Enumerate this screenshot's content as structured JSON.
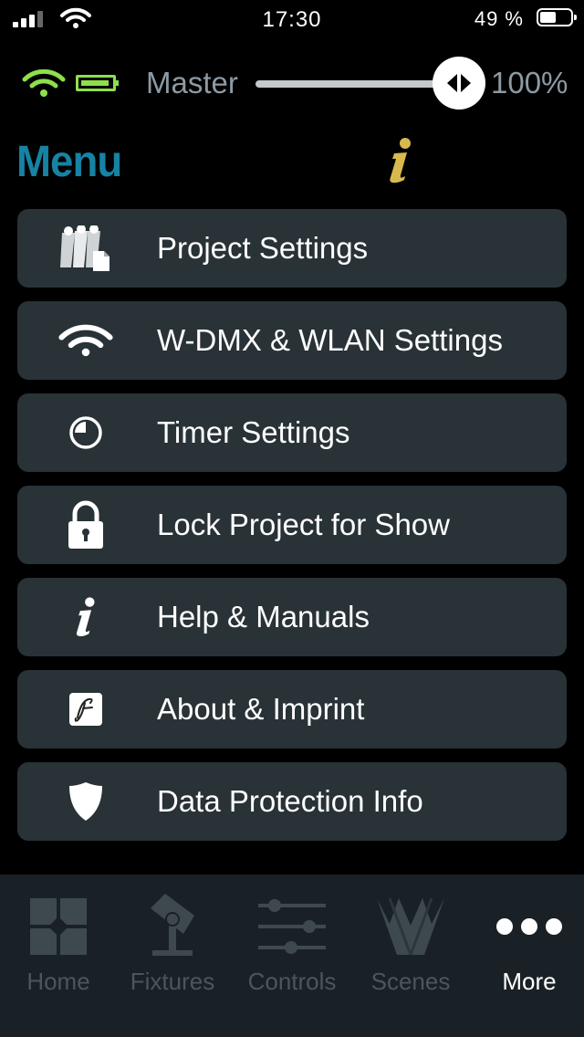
{
  "status_bar": {
    "time": "17:30",
    "battery_percent": "49 %",
    "signal_bars": 3,
    "battery_level": 0.49
  },
  "master": {
    "label": "Master",
    "value_text": "100%",
    "level": 1.0,
    "connection_icon": "wifi-icon",
    "device_battery_icon": "battery-icon",
    "accent_color": "#8ee04b"
  },
  "menu": {
    "title": "Menu",
    "title_color": "#1683a3",
    "info_icon": "info-icon",
    "info_color": "#d8b94e",
    "items": [
      {
        "label": "Project Settings",
        "icon": "fixtures-document-icon"
      },
      {
        "label": "W-DMX & WLAN Settings",
        "icon": "wifi-icon"
      },
      {
        "label": "Timer Settings",
        "icon": "clock-icon"
      },
      {
        "label": "Lock Project for Show",
        "icon": "lock-icon"
      },
      {
        "label": "Help & Manuals",
        "icon": "info-icon"
      },
      {
        "label": "About & Imprint",
        "icon": "signature-icon"
      },
      {
        "label": "Data Protection Info",
        "icon": "shield-icon"
      }
    ]
  },
  "tabbar": {
    "active": "More",
    "tabs": [
      {
        "label": "Home",
        "icon": "home-grid-icon"
      },
      {
        "label": "Fixtures",
        "icon": "fixture-icon"
      },
      {
        "label": "Controls",
        "icon": "sliders-icon"
      },
      {
        "label": "Scenes",
        "icon": "scenes-icon"
      },
      {
        "label": "More",
        "icon": "more-dots-icon"
      }
    ]
  }
}
